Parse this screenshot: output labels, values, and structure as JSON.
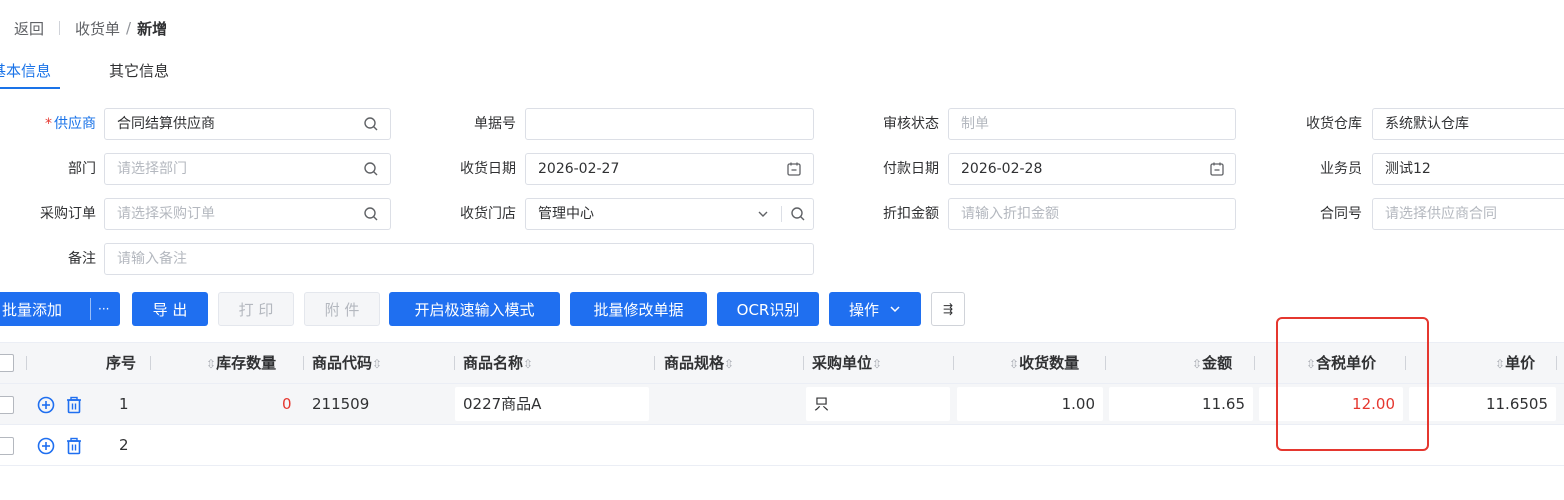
{
  "breadcrumb": {
    "back": "返回",
    "parent": "收货单",
    "separator": "/",
    "current": "新增"
  },
  "tabs": [
    {
      "label": "基本信息",
      "active": true
    },
    {
      "label": "其它信息",
      "active": false
    }
  ],
  "form": {
    "supplier": {
      "required_mark": "*",
      "label": "供应商",
      "value": "合同结算供应商"
    },
    "doc_no": {
      "label": "单据号",
      "value": ""
    },
    "audit_status": {
      "label": "审核状态",
      "placeholder": "制单"
    },
    "warehouse": {
      "label": "收货仓库",
      "value": "系统默认仓库"
    },
    "department": {
      "label": "部门",
      "placeholder": "请选择部门"
    },
    "receive_date": {
      "label": "收货日期",
      "value": "2026-02-27"
    },
    "pay_date": {
      "label": "付款日期",
      "value": "2026-02-28"
    },
    "salesman": {
      "label": "业务员",
      "value": "测试12"
    },
    "purchase_order": {
      "label": "采购订单",
      "placeholder": "请选择采购订单"
    },
    "store": {
      "label": "收货门店",
      "value": "管理中心"
    },
    "discount": {
      "label": "折扣金额",
      "placeholder": "请输入折扣金额"
    },
    "contract": {
      "label": "合同号",
      "placeholder": "请选择供应商合同"
    },
    "remark": {
      "label": "备注",
      "placeholder": "请输入备注"
    }
  },
  "toolbar": {
    "batch_add": "批量添加",
    "more": "···",
    "export": "导 出",
    "print": "打 印",
    "attach": "附 件",
    "fast_input": "开启极速输入模式",
    "batch_edit": "批量修改单据",
    "ocr": "OCR识别",
    "operate": "操作",
    "column_setting": "⇶"
  },
  "table": {
    "headers": {
      "seq": "序号",
      "stock": "库存数量",
      "code": "商品代码",
      "name": "商品名称",
      "spec": "商品规格",
      "unit": "采购单位",
      "qty": "收货数量",
      "amount": "金额",
      "tax_price": "含税单价",
      "price": "单价"
    },
    "rows": [
      {
        "seq": "1",
        "stock": "0",
        "code": "211509",
        "name": "0227商品A",
        "spec": "",
        "unit": "只",
        "qty": "1.00",
        "amount": "11.65",
        "tax_price": "12.00",
        "price": "11.6505"
      },
      {
        "seq": "2"
      }
    ]
  },
  "colors": {
    "primary": "#1f6ff0",
    "link": "#1a73e8",
    "danger": "#e5372f",
    "highlight_box": "#e5372f"
  },
  "icons": [
    "search-icon",
    "calendar-icon",
    "chevron-down-icon",
    "add-circle-icon",
    "trash-icon",
    "chevron-down-icon",
    "column-setting-icon"
  ]
}
